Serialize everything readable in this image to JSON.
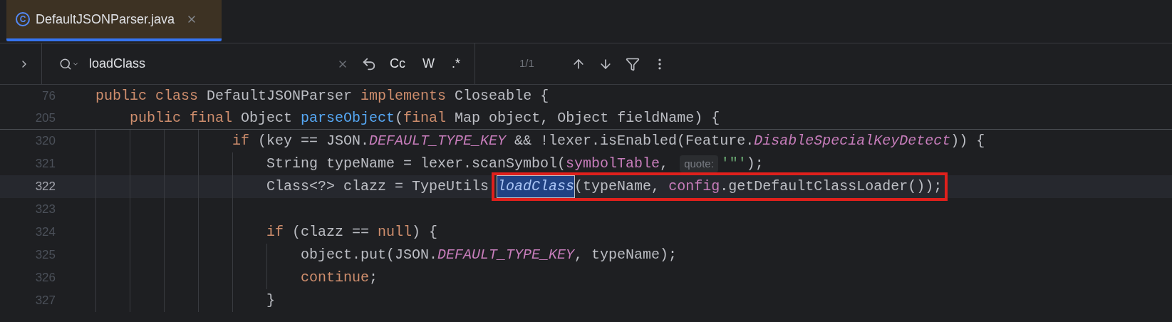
{
  "tabs": [
    {
      "icon": "C",
      "label": "DefaultJSONParser.java",
      "selected": true
    }
  ],
  "find_bar": {
    "value": "loadClass",
    "options": [
      {
        "label": "Cc"
      },
      {
        "label": "W"
      },
      {
        "label": ".*"
      }
    ],
    "match_count": "1/1"
  },
  "sticky_lines": [
    {
      "number": "76",
      "tokens": [
        {
          "text": "public class",
          "kind": "keyword"
        },
        {
          "text": " DefaultJSONParser ",
          "kind": "plain"
        },
        {
          "text": "implements",
          "kind": "keyword"
        },
        {
          "text": " Closeable {",
          "kind": "plain"
        }
      ]
    },
    {
      "number": "205",
      "tokens": [
        {
          "text": "    public final",
          "kind": "keyword"
        },
        {
          "text": " Object ",
          "kind": "plain"
        },
        {
          "text": "parseObject",
          "kind": "declaration"
        },
        {
          "text": "(",
          "kind": "plain"
        },
        {
          "text": "final",
          "kind": "keyword"
        },
        {
          "text": " Map object, Object fieldName) {",
          "kind": "plain"
        }
      ]
    }
  ],
  "lines": [
    {
      "number": "320",
      "current": false,
      "annotated": false,
      "tokens": [
        {
          "text": "                if",
          "kind": "keyword"
        },
        {
          "text": " (key == JSON.",
          "kind": "plain"
        },
        {
          "text": "DEFAULT_TYPE_KEY",
          "kind": "constant"
        },
        {
          "text": " && !lexer.isEnabled(Feature.",
          "kind": "plain"
        },
        {
          "text": "DisableSpecialKeyDetect",
          "kind": "constant"
        },
        {
          "text": ")) {",
          "kind": "plain"
        }
      ]
    },
    {
      "number": "321",
      "current": false,
      "annotated": false,
      "tokens": [
        {
          "text": "                    String typeName = lexer.scanSymbol(",
          "kind": "plain"
        },
        {
          "text": "symbolTable",
          "kind": "field"
        },
        {
          "text": ", ",
          "kind": "plain"
        },
        {
          "text": "quote:",
          "kind": "hint"
        },
        {
          "text": "'\"'",
          "kind": "string"
        },
        {
          "text": ");",
          "kind": "plain"
        }
      ]
    },
    {
      "number": "322",
      "current": true,
      "annotated": true,
      "tokens": [
        {
          "text": "                    Class<?> clazz = TypeUtils ",
          "kind": "plain"
        },
        {
          "text": "loadClass",
          "kind": "match"
        },
        {
          "text": "(typeName, ",
          "kind": "plain"
        },
        {
          "text": "config",
          "kind": "field"
        },
        {
          "text": ".getDefaultClassLoader());",
          "kind": "plain"
        }
      ]
    },
    {
      "number": "323",
      "current": false,
      "annotated": false
    },
    {
      "number": "324",
      "current": false,
      "annotated": false,
      "tokens": [
        {
          "text": "                    if",
          "kind": "keyword"
        },
        {
          "text": " (clazz == ",
          "kind": "plain"
        },
        {
          "text": "null",
          "kind": "keyword"
        },
        {
          "text": ") {",
          "kind": "plain"
        }
      ]
    },
    {
      "number": "325",
      "current": false,
      "annotated": false,
      "tokens": [
        {
          "text": "                        object.put(JSON.",
          "kind": "plain"
        },
        {
          "text": "DEFAULT_TYPE_KEY",
          "kind": "constant"
        },
        {
          "text": ", typeName);",
          "kind": "plain"
        }
      ]
    },
    {
      "number": "326",
      "current": false,
      "annotated": false,
      "tokens": [
        {
          "text": "                        continue",
          "kind": "keyword"
        },
        {
          "text": ";",
          "kind": "plain"
        }
      ]
    },
    {
      "number": "327",
      "current": false,
      "annotated": false,
      "tokens": [
        {
          "text": "                    }",
          "kind": "plain"
        }
      ]
    }
  ]
}
